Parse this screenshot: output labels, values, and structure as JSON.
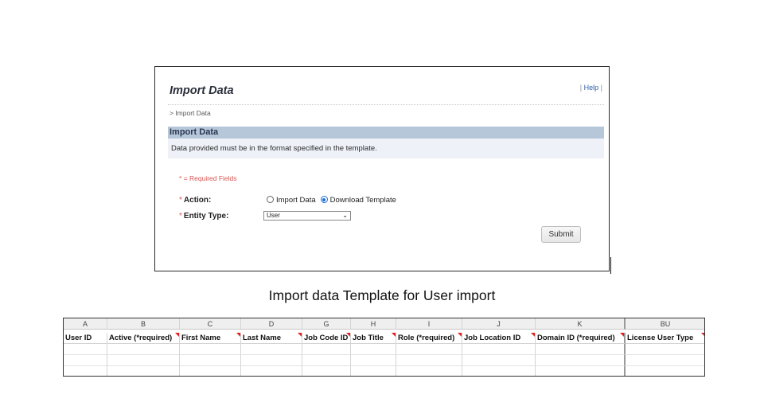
{
  "import_panel": {
    "title": "Import Data",
    "help_label": "Help",
    "breadcrumb": "> Import Data",
    "section_title": "Import Data",
    "section_text": "Data provided must be in the format specified in the template.",
    "required_note": "* = Required Fields",
    "action_label": "Action",
    "action_options": [
      {
        "label": "Import Data",
        "selected": false
      },
      {
        "label": "Download Template",
        "selected": true
      }
    ],
    "entity_type_label": "Entity Type",
    "entity_type_value": "User",
    "submit_label": "Submit"
  },
  "caption": "Import data Template for User import",
  "spreadsheet": {
    "column_letters": [
      "A",
      "B",
      "C",
      "D",
      "G",
      "H",
      "I",
      "J",
      "K",
      "BU"
    ],
    "headers": [
      "User ID",
      "Active (*required)",
      "First Name",
      "Last Name",
      "Job Code ID",
      "Job Title",
      "Role (*required)",
      "Job Location ID",
      "Domain ID (*required)",
      "License User Type"
    ]
  },
  "colors": {
    "section_bar": "#b7c7da",
    "section_body": "#eef1f8",
    "required_red": "#d9534f",
    "link_blue": "#2b5fa7",
    "comment_marker": "#e02020"
  }
}
